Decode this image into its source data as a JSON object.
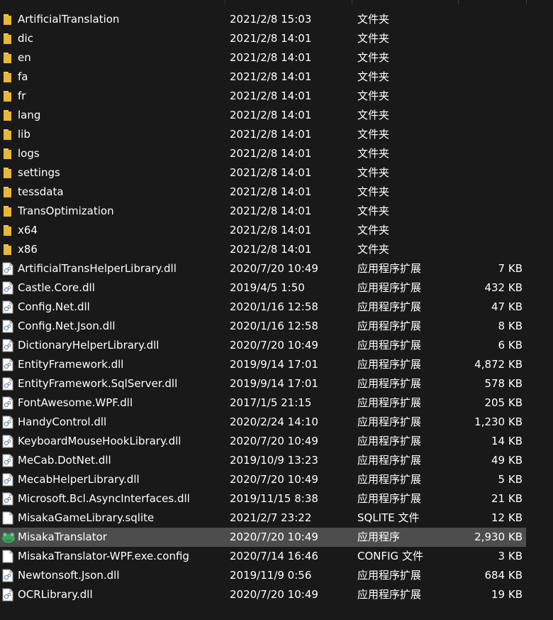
{
  "colors": {
    "background": "#191919",
    "selected_row": "#4d4d4d",
    "folder": "#f2c94c",
    "text": "#ffffff"
  },
  "files": [
    {
      "name": "ArtificialTranslation",
      "date": "2021/2/8 15:03",
      "type": "文件夹",
      "size": "",
      "icon": "folder-icon"
    },
    {
      "name": "dic",
      "date": "2021/2/8 14:01",
      "type": "文件夹",
      "size": "",
      "icon": "folder-icon"
    },
    {
      "name": "en",
      "date": "2021/2/8 14:01",
      "type": "文件夹",
      "size": "",
      "icon": "folder-icon"
    },
    {
      "name": "fa",
      "date": "2021/2/8 14:01",
      "type": "文件夹",
      "size": "",
      "icon": "folder-icon"
    },
    {
      "name": "fr",
      "date": "2021/2/8 14:01",
      "type": "文件夹",
      "size": "",
      "icon": "folder-icon"
    },
    {
      "name": "lang",
      "date": "2021/2/8 14:01",
      "type": "文件夹",
      "size": "",
      "icon": "folder-icon"
    },
    {
      "name": "lib",
      "date": "2021/2/8 14:01",
      "type": "文件夹",
      "size": "",
      "icon": "folder-icon"
    },
    {
      "name": "logs",
      "date": "2021/2/8 14:01",
      "type": "文件夹",
      "size": "",
      "icon": "folder-icon"
    },
    {
      "name": "settings",
      "date": "2021/2/8 14:01",
      "type": "文件夹",
      "size": "",
      "icon": "folder-icon"
    },
    {
      "name": "tessdata",
      "date": "2021/2/8 14:01",
      "type": "文件夹",
      "size": "",
      "icon": "folder-icon"
    },
    {
      "name": "TransOptimization",
      "date": "2021/2/8 14:01",
      "type": "文件夹",
      "size": "",
      "icon": "folder-icon"
    },
    {
      "name": "x64",
      "date": "2021/2/8 14:01",
      "type": "文件夹",
      "size": "",
      "icon": "folder-icon"
    },
    {
      "name": "x86",
      "date": "2021/2/8 14:01",
      "type": "文件夹",
      "size": "",
      "icon": "folder-icon"
    },
    {
      "name": "ArtificialTransHelperLibrary.dll",
      "date": "2020/7/20 10:49",
      "type": "应用程序扩展",
      "size": "7 KB",
      "icon": "dll-file-icon"
    },
    {
      "name": "Castle.Core.dll",
      "date": "2019/4/5 1:50",
      "type": "应用程序扩展",
      "size": "432 KB",
      "icon": "dll-file-icon"
    },
    {
      "name": "Config.Net.dll",
      "date": "2020/1/16 12:58",
      "type": "应用程序扩展",
      "size": "47 KB",
      "icon": "dll-file-icon"
    },
    {
      "name": "Config.Net.Json.dll",
      "date": "2020/1/16 12:58",
      "type": "应用程序扩展",
      "size": "8 KB",
      "icon": "dll-file-icon"
    },
    {
      "name": "DictionaryHelperLibrary.dll",
      "date": "2020/7/20 10:49",
      "type": "应用程序扩展",
      "size": "6 KB",
      "icon": "dll-file-icon"
    },
    {
      "name": "EntityFramework.dll",
      "date": "2019/9/14 17:01",
      "type": "应用程序扩展",
      "size": "4,872 KB",
      "icon": "dll-file-icon"
    },
    {
      "name": "EntityFramework.SqlServer.dll",
      "date": "2019/9/14 17:01",
      "type": "应用程序扩展",
      "size": "578 KB",
      "icon": "dll-file-icon"
    },
    {
      "name": "FontAwesome.WPF.dll",
      "date": "2017/1/5 21:15",
      "type": "应用程序扩展",
      "size": "205 KB",
      "icon": "dll-file-icon"
    },
    {
      "name": "HandyControl.dll",
      "date": "2020/2/24 14:10",
      "type": "应用程序扩展",
      "size": "1,230 KB",
      "icon": "dll-file-icon"
    },
    {
      "name": "KeyboardMouseHookLibrary.dll",
      "date": "2020/7/20 10:49",
      "type": "应用程序扩展",
      "size": "14 KB",
      "icon": "dll-file-icon"
    },
    {
      "name": "MeCab.DotNet.dll",
      "date": "2019/10/9 13:23",
      "type": "应用程序扩展",
      "size": "49 KB",
      "icon": "dll-file-icon"
    },
    {
      "name": "MecabHelperLibrary.dll",
      "date": "2020/7/20 10:49",
      "type": "应用程序扩展",
      "size": "5 KB",
      "icon": "dll-file-icon"
    },
    {
      "name": "Microsoft.Bcl.AsyncInterfaces.dll",
      "date": "2019/11/15 8:38",
      "type": "应用程序扩展",
      "size": "21 KB",
      "icon": "dll-file-icon"
    },
    {
      "name": "MisakaGameLibrary.sqlite",
      "date": "2021/2/7 23:22",
      "type": "SQLITE 文件",
      "size": "12 KB",
      "icon": "blank-file-icon"
    },
    {
      "name": "MisakaTranslator",
      "date": "2020/7/20 10:49",
      "type": "应用程序",
      "size": "2,930 KB",
      "icon": "frog-app-icon",
      "selected": true
    },
    {
      "name": "MisakaTranslator-WPF.exe.config",
      "date": "2020/7/14 16:46",
      "type": "CONFIG 文件",
      "size": "3 KB",
      "icon": "blank-file-icon"
    },
    {
      "name": "Newtonsoft.Json.dll",
      "date": "2019/11/9 0:56",
      "type": "应用程序扩展",
      "size": "684 KB",
      "icon": "dll-file-icon"
    },
    {
      "name": "OCRLibrary.dll",
      "date": "2020/7/20 10:49",
      "type": "应用程序扩展",
      "size": "19 KB",
      "icon": "dll-file-icon"
    }
  ]
}
